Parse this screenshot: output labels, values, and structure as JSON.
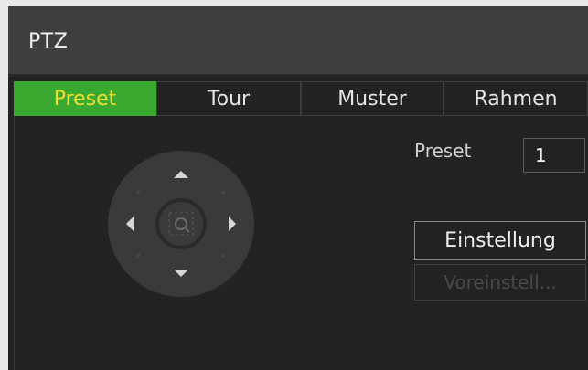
{
  "window": {
    "title": "PTZ"
  },
  "tabs": [
    {
      "label": "Preset",
      "active": true
    },
    {
      "label": "Tour",
      "active": false
    },
    {
      "label": "Muster",
      "active": false
    },
    {
      "label": "Rahmen",
      "active": false
    }
  ],
  "preset": {
    "label": "Preset",
    "value": "1"
  },
  "buttons": {
    "settings": "Einstellung",
    "set_preset": "Voreinstell..."
  },
  "colors": {
    "active_tab_bg": "#39a92f",
    "active_tab_text": "#f1dd32",
    "panel_bg": "#232323",
    "titlebar_bg": "#3f3f3f"
  },
  "icons": {
    "joystick": "ptz-direction-pad",
    "center": "zoom-magnifier-icon"
  }
}
